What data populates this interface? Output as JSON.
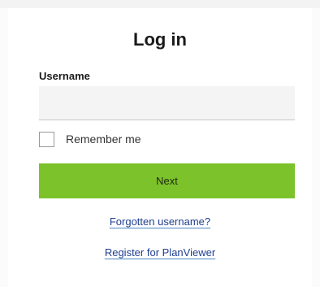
{
  "login": {
    "title": "Log in",
    "username_label": "Username",
    "username_value": "",
    "remember_label": "Remember me",
    "remember_checked": false,
    "next_label": "Next",
    "forgot_link": "Forgotten username?",
    "register_link": "Register for PlanViewer"
  },
  "colors": {
    "primary_button": "#7cc22b",
    "link": "#1f3e8f",
    "link_underline": "#4a86c5",
    "input_background": "#f4f4f4"
  }
}
